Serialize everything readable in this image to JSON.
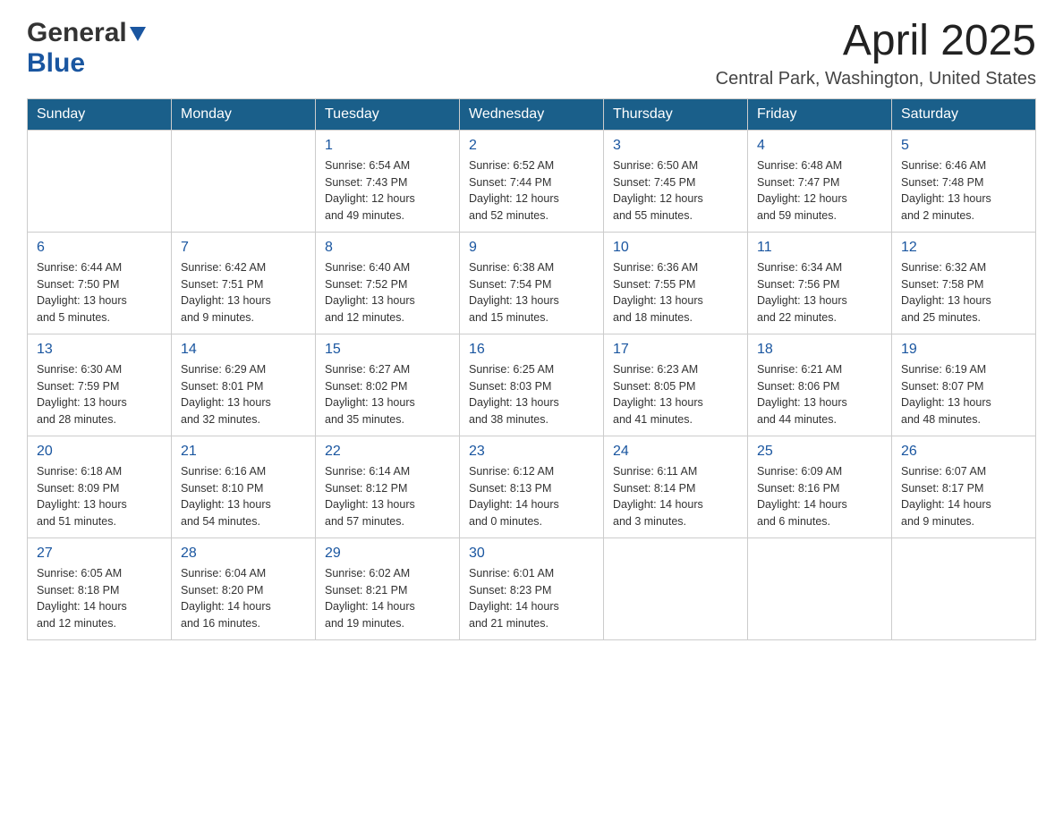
{
  "header": {
    "logo_general": "General",
    "logo_blue": "Blue",
    "month_title": "April 2025",
    "location": "Central Park, Washington, United States"
  },
  "weekdays": [
    "Sunday",
    "Monday",
    "Tuesday",
    "Wednesday",
    "Thursday",
    "Friday",
    "Saturday"
  ],
  "weeks": [
    [
      {
        "day": "",
        "sunrise": "",
        "sunset": "",
        "daylight": ""
      },
      {
        "day": "",
        "sunrise": "",
        "sunset": "",
        "daylight": ""
      },
      {
        "day": "1",
        "sunrise": "Sunrise: 6:54 AM",
        "sunset": "Sunset: 7:43 PM",
        "daylight": "Daylight: 12 hours and 49 minutes."
      },
      {
        "day": "2",
        "sunrise": "Sunrise: 6:52 AM",
        "sunset": "Sunset: 7:44 PM",
        "daylight": "Daylight: 12 hours and 52 minutes."
      },
      {
        "day": "3",
        "sunrise": "Sunrise: 6:50 AM",
        "sunset": "Sunset: 7:45 PM",
        "daylight": "Daylight: 12 hours and 55 minutes."
      },
      {
        "day": "4",
        "sunrise": "Sunrise: 6:48 AM",
        "sunset": "Sunset: 7:47 PM",
        "daylight": "Daylight: 12 hours and 59 minutes."
      },
      {
        "day": "5",
        "sunrise": "Sunrise: 6:46 AM",
        "sunset": "Sunset: 7:48 PM",
        "daylight": "Daylight: 13 hours and 2 minutes."
      }
    ],
    [
      {
        "day": "6",
        "sunrise": "Sunrise: 6:44 AM",
        "sunset": "Sunset: 7:50 PM",
        "daylight": "Daylight: 13 hours and 5 minutes."
      },
      {
        "day": "7",
        "sunrise": "Sunrise: 6:42 AM",
        "sunset": "Sunset: 7:51 PM",
        "daylight": "Daylight: 13 hours and 9 minutes."
      },
      {
        "day": "8",
        "sunrise": "Sunrise: 6:40 AM",
        "sunset": "Sunset: 7:52 PM",
        "daylight": "Daylight: 13 hours and 12 minutes."
      },
      {
        "day": "9",
        "sunrise": "Sunrise: 6:38 AM",
        "sunset": "Sunset: 7:54 PM",
        "daylight": "Daylight: 13 hours and 15 minutes."
      },
      {
        "day": "10",
        "sunrise": "Sunrise: 6:36 AM",
        "sunset": "Sunset: 7:55 PM",
        "daylight": "Daylight: 13 hours and 18 minutes."
      },
      {
        "day": "11",
        "sunrise": "Sunrise: 6:34 AM",
        "sunset": "Sunset: 7:56 PM",
        "daylight": "Daylight: 13 hours and 22 minutes."
      },
      {
        "day": "12",
        "sunrise": "Sunrise: 6:32 AM",
        "sunset": "Sunset: 7:58 PM",
        "daylight": "Daylight: 13 hours and 25 minutes."
      }
    ],
    [
      {
        "day": "13",
        "sunrise": "Sunrise: 6:30 AM",
        "sunset": "Sunset: 7:59 PM",
        "daylight": "Daylight: 13 hours and 28 minutes."
      },
      {
        "day": "14",
        "sunrise": "Sunrise: 6:29 AM",
        "sunset": "Sunset: 8:01 PM",
        "daylight": "Daylight: 13 hours and 32 minutes."
      },
      {
        "day": "15",
        "sunrise": "Sunrise: 6:27 AM",
        "sunset": "Sunset: 8:02 PM",
        "daylight": "Daylight: 13 hours and 35 minutes."
      },
      {
        "day": "16",
        "sunrise": "Sunrise: 6:25 AM",
        "sunset": "Sunset: 8:03 PM",
        "daylight": "Daylight: 13 hours and 38 minutes."
      },
      {
        "day": "17",
        "sunrise": "Sunrise: 6:23 AM",
        "sunset": "Sunset: 8:05 PM",
        "daylight": "Daylight: 13 hours and 41 minutes."
      },
      {
        "day": "18",
        "sunrise": "Sunrise: 6:21 AM",
        "sunset": "Sunset: 8:06 PM",
        "daylight": "Daylight: 13 hours and 44 minutes."
      },
      {
        "day": "19",
        "sunrise": "Sunrise: 6:19 AM",
        "sunset": "Sunset: 8:07 PM",
        "daylight": "Daylight: 13 hours and 48 minutes."
      }
    ],
    [
      {
        "day": "20",
        "sunrise": "Sunrise: 6:18 AM",
        "sunset": "Sunset: 8:09 PM",
        "daylight": "Daylight: 13 hours and 51 minutes."
      },
      {
        "day": "21",
        "sunrise": "Sunrise: 6:16 AM",
        "sunset": "Sunset: 8:10 PM",
        "daylight": "Daylight: 13 hours and 54 minutes."
      },
      {
        "day": "22",
        "sunrise": "Sunrise: 6:14 AM",
        "sunset": "Sunset: 8:12 PM",
        "daylight": "Daylight: 13 hours and 57 minutes."
      },
      {
        "day": "23",
        "sunrise": "Sunrise: 6:12 AM",
        "sunset": "Sunset: 8:13 PM",
        "daylight": "Daylight: 14 hours and 0 minutes."
      },
      {
        "day": "24",
        "sunrise": "Sunrise: 6:11 AM",
        "sunset": "Sunset: 8:14 PM",
        "daylight": "Daylight: 14 hours and 3 minutes."
      },
      {
        "day": "25",
        "sunrise": "Sunrise: 6:09 AM",
        "sunset": "Sunset: 8:16 PM",
        "daylight": "Daylight: 14 hours and 6 minutes."
      },
      {
        "day": "26",
        "sunrise": "Sunrise: 6:07 AM",
        "sunset": "Sunset: 8:17 PM",
        "daylight": "Daylight: 14 hours and 9 minutes."
      }
    ],
    [
      {
        "day": "27",
        "sunrise": "Sunrise: 6:05 AM",
        "sunset": "Sunset: 8:18 PM",
        "daylight": "Daylight: 14 hours and 12 minutes."
      },
      {
        "day": "28",
        "sunrise": "Sunrise: 6:04 AM",
        "sunset": "Sunset: 8:20 PM",
        "daylight": "Daylight: 14 hours and 16 minutes."
      },
      {
        "day": "29",
        "sunrise": "Sunrise: 6:02 AM",
        "sunset": "Sunset: 8:21 PM",
        "daylight": "Daylight: 14 hours and 19 minutes."
      },
      {
        "day": "30",
        "sunrise": "Sunrise: 6:01 AM",
        "sunset": "Sunset: 8:23 PM",
        "daylight": "Daylight: 14 hours and 21 minutes."
      },
      {
        "day": "",
        "sunrise": "",
        "sunset": "",
        "daylight": ""
      },
      {
        "day": "",
        "sunrise": "",
        "sunset": "",
        "daylight": ""
      },
      {
        "day": "",
        "sunrise": "",
        "sunset": "",
        "daylight": ""
      }
    ]
  ]
}
